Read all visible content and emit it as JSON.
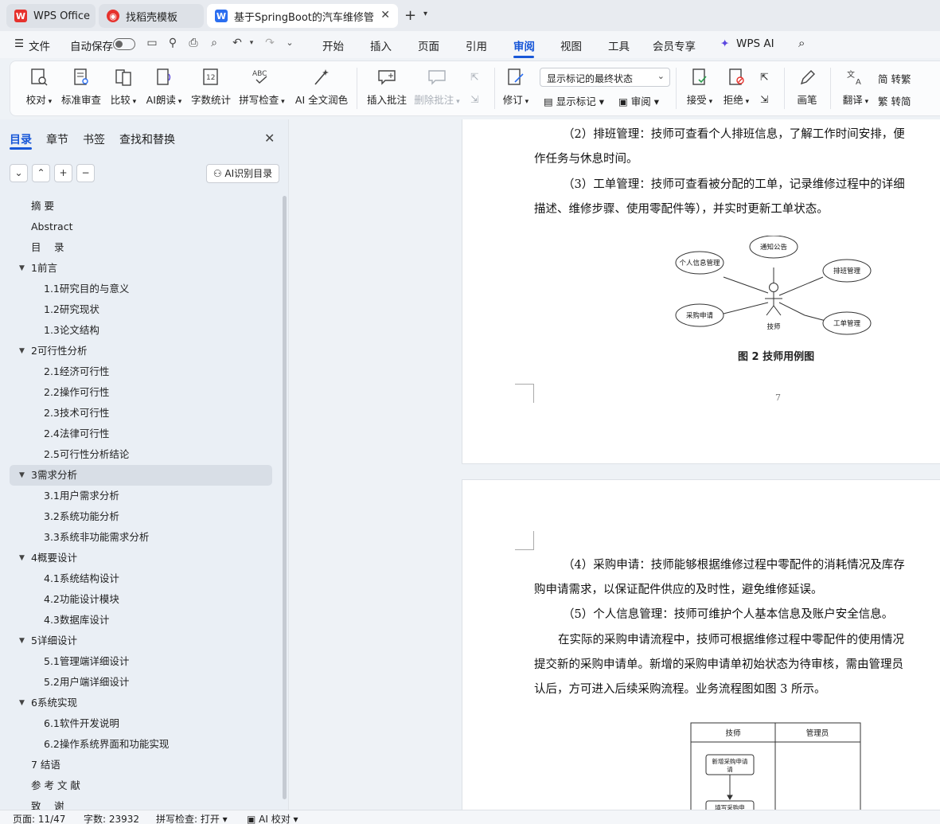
{
  "tabs": {
    "wps": "WPS Office",
    "template": "找稻壳模板",
    "document": "基于SpringBoot的汽车维修管理系统"
  },
  "menu": {
    "file": "文件",
    "autosave": "自动保存",
    "items": [
      "开始",
      "插入",
      "页面",
      "引用",
      "审阅",
      "视图",
      "工具",
      "会员专享",
      "WPS AI"
    ],
    "active": "审阅"
  },
  "ribbon": {
    "proofread": "校对",
    "standard_review": "标准审查",
    "compare": "比较",
    "ai_read": "AI朗读",
    "word_count": "字数统计",
    "spell_check": "拼写检查",
    "ai_polish": "AI 全文润色",
    "insert_comment": "插入批注",
    "delete_comment": "删除批注",
    "revise": "修订",
    "display_mode": "显示标记的最终状态",
    "show_marks": "显示标记",
    "review": "审阅",
    "accept": "接受",
    "reject": "拒绝",
    "pen": "画笔",
    "translate": "翻译",
    "to_traditional": "转繁",
    "to_simplified": "转简"
  },
  "sidebar": {
    "tabs": [
      "目录",
      "章节",
      "书签",
      "查找和替换"
    ],
    "ai_toc": "AI识别目录",
    "toc": [
      {
        "label": "摘 要",
        "level": 0,
        "arrow": false
      },
      {
        "label": "Abstract",
        "level": 0,
        "arrow": false
      },
      {
        "label": "目　 录",
        "level": 0,
        "arrow": false
      },
      {
        "label": "1前言",
        "level": 0,
        "arrow": true
      },
      {
        "label": "1.1研究目的与意义",
        "level": 1,
        "arrow": false
      },
      {
        "label": "1.2研究现状",
        "level": 1,
        "arrow": false
      },
      {
        "label": "1.3论文结构",
        "level": 1,
        "arrow": false
      },
      {
        "label": "2可行性分析",
        "level": 0,
        "arrow": true
      },
      {
        "label": "2.1经济可行性",
        "level": 1,
        "arrow": false
      },
      {
        "label": "2.2操作可行性",
        "level": 1,
        "arrow": false
      },
      {
        "label": "2.3技术可行性",
        "level": 1,
        "arrow": false
      },
      {
        "label": "2.4法律可行性",
        "level": 1,
        "arrow": false
      },
      {
        "label": "2.5可行性分析结论",
        "level": 1,
        "arrow": false
      },
      {
        "label": "3需求分析",
        "level": 0,
        "arrow": true,
        "selected": true
      },
      {
        "label": "3.1用户需求分析",
        "level": 1,
        "arrow": false
      },
      {
        "label": "3.2系统功能分析",
        "level": 1,
        "arrow": false
      },
      {
        "label": "3.3系统非功能需求分析",
        "level": 1,
        "arrow": false
      },
      {
        "label": "4概要设计",
        "level": 0,
        "arrow": true
      },
      {
        "label": "4.1系统结构设计",
        "level": 1,
        "arrow": false
      },
      {
        "label": "4.2功能设计模块",
        "level": 1,
        "arrow": false
      },
      {
        "label": "4.3数据库设计",
        "level": 1,
        "arrow": false
      },
      {
        "label": "5详细设计",
        "level": 0,
        "arrow": true
      },
      {
        "label": "5.1管理端详细设计",
        "level": 1,
        "arrow": false
      },
      {
        "label": "5.2用户端详细设计",
        "level": 1,
        "arrow": false
      },
      {
        "label": "6系统实现",
        "level": 0,
        "arrow": true
      },
      {
        "label": "6.1软件开发说明",
        "level": 1,
        "arrow": false
      },
      {
        "label": "6.2操作系统界面和功能实现",
        "level": 1,
        "arrow": false
      },
      {
        "label": "7 结语",
        "level": 0,
        "arrow": false
      },
      {
        "label": "参 考 文 献",
        "level": 0,
        "arrow": false
      },
      {
        "label": "致　 谢",
        "level": 0,
        "arrow": false
      }
    ]
  },
  "document": {
    "page1": {
      "lines": [
        "（2）排班管理：技师可查看个人排班信息，了解工作时间安排，便",
        "作任务与休息时间。",
        "（3）工单管理：技师可查看被分配的工单，记录维修过程中的详细",
        "描述、维修步骤、使用零配件等），并实时更新工单状态。"
      ],
      "figure": {
        "actor": "技师",
        "usecases": [
          "通知公告",
          "个人信息管理",
          "排班管理",
          "采购申请",
          "工单管理"
        ],
        "caption": "图 2 技师用例图"
      },
      "page_number": "7"
    },
    "page2": {
      "lines": [
        "（4）采购申请：技师能够根据维修过程中零配件的消耗情况及库存",
        "购申请需求，以保证配件供应的及时性，避免维修延误。",
        "（5）个人信息管理：技师可维护个人基本信息及账户安全信息。",
        "在实际的采购申请流程中，技师可根据维修过程中零配件的使用情况",
        "提交新的采购申请单。新增的采购申请单初始状态为待审核，需由管理员",
        "认后，方可进入后续采购流程。业务流程图如图 3 所示。"
      ],
      "flow": {
        "lanes": [
          "技师",
          "管理员"
        ],
        "steps": [
          "新增采购申请",
          "填写采购申"
        ]
      }
    }
  },
  "status": {
    "page": "页面: 11/47",
    "words": "字数: 23932",
    "spell": "拼写检查: 打开",
    "ai_check": "AI 校对"
  }
}
